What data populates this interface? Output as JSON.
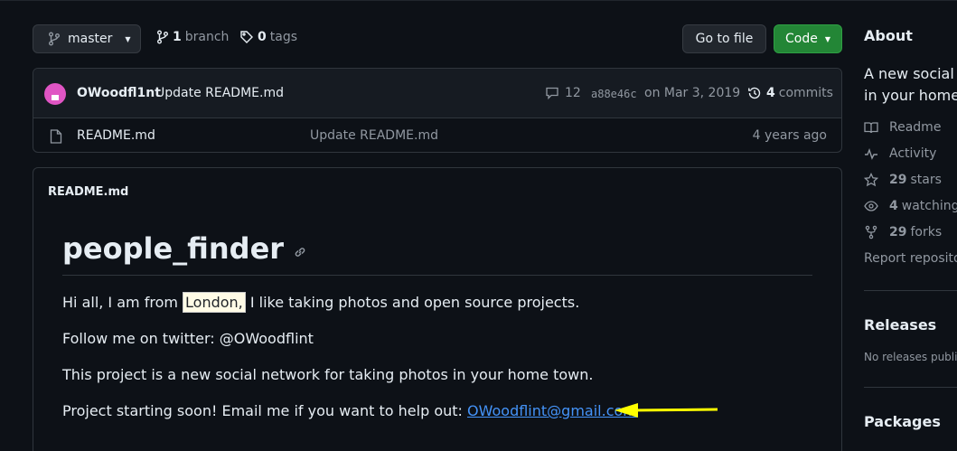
{
  "toolbar": {
    "branch_name": "master",
    "branch_count": "1",
    "branch_label": "branch",
    "tag_count": "0",
    "tag_label": "tags",
    "go_to_file": "Go to file",
    "code_label": "Code"
  },
  "latest_commit": {
    "author": "OWoodfl1nt",
    "message": "Update README.md",
    "comment_count": "12",
    "sha": "a88e46c",
    "date": "on Mar 3, 2019",
    "commit_count": "4",
    "commit_label": "commits"
  },
  "files": [
    {
      "name": "README.md",
      "message": "Update README.md",
      "age": "4 years ago"
    }
  ],
  "readme": {
    "header": "README.md",
    "title": "people_finder",
    "p1_before": "Hi all, I am from ",
    "p1_highlight": "London,",
    "p1_after": " I like taking photos and open source projects.",
    "p2": "Follow me on twitter: @OWoodflint",
    "p3": "This project is a new social network for taking photos in your home town.",
    "p4_before": "Project starting soon! Email me if you want to help out: ",
    "p4_email": "OWoodflint@gmail.com"
  },
  "sidebar": {
    "about_title": "About",
    "description_line1": "A new social n",
    "description_line2": "in your home",
    "readme": "Readme",
    "activity": "Activity",
    "stars_count": "29",
    "stars_label": "stars",
    "watching_count": "4",
    "watching_label": "watching",
    "forks_count": "29",
    "forks_label": "forks",
    "report": "Report reposito",
    "releases_title": "Releases",
    "no_releases": "No releases publis",
    "packages_title": "Packages"
  },
  "colors": {
    "background": "#0d1117",
    "code_button": "#238636",
    "link": "#4493f8",
    "arrow": "#ffff00"
  }
}
